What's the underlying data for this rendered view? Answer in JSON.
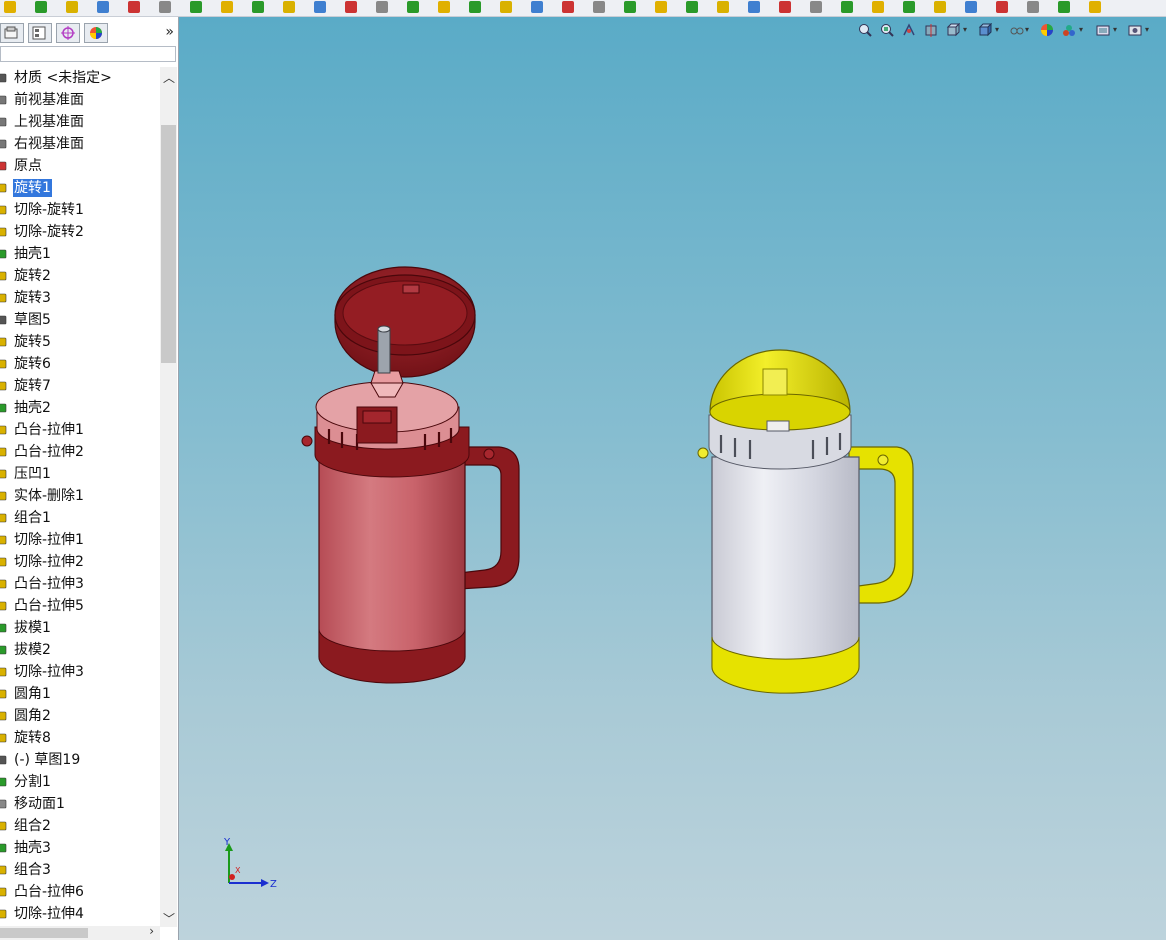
{
  "window": {
    "toolbar": {
      "icon_count": 36
    },
    "panel": {
      "tabs": [
        "feature-manager-tab",
        "property-manager-tab",
        "configuration-manager-tab",
        "display-manager-tab"
      ],
      "expand_glyph": "»"
    },
    "feature_tree": {
      "items": [
        {
          "label": "材质 <未指定>",
          "icon": "material-icon",
          "selected": false
        },
        {
          "label": "前视基准面",
          "icon": "plane-icon",
          "selected": false
        },
        {
          "label": "上视基准面",
          "icon": "plane-icon",
          "selected": false
        },
        {
          "label": "右视基准面",
          "icon": "plane-icon",
          "selected": false
        },
        {
          "label": "原点",
          "icon": "origin-icon",
          "selected": false
        },
        {
          "label": "旋转1",
          "icon": "revolve-icon",
          "selected": true
        },
        {
          "label": "切除-旋转1",
          "icon": "cut-revolve-icon",
          "selected": false
        },
        {
          "label": "切除-旋转2",
          "icon": "cut-revolve-icon",
          "selected": false
        },
        {
          "label": "抽壳1",
          "icon": "shell-icon",
          "selected": false
        },
        {
          "label": "旋转2",
          "icon": "revolve-icon",
          "selected": false
        },
        {
          "label": "旋转3",
          "icon": "revolve-icon",
          "selected": false
        },
        {
          "label": "草图5",
          "icon": "sketch-icon",
          "selected": false
        },
        {
          "label": "旋转5",
          "icon": "revolve-icon",
          "selected": false
        },
        {
          "label": "旋转6",
          "icon": "revolve-icon",
          "selected": false
        },
        {
          "label": "旋转7",
          "icon": "revolve-icon",
          "selected": false
        },
        {
          "label": "抽壳2",
          "icon": "shell-icon",
          "selected": false
        },
        {
          "label": "凸台-拉伸1",
          "icon": "boss-extrude-icon",
          "selected": false
        },
        {
          "label": "凸台-拉伸2",
          "icon": "boss-extrude-icon",
          "selected": false
        },
        {
          "label": "压凹1",
          "icon": "indent-icon",
          "selected": false
        },
        {
          "label": "实体-删除1",
          "icon": "delete-body-icon",
          "selected": false
        },
        {
          "label": "组合1",
          "icon": "combine-icon",
          "selected": false
        },
        {
          "label": "切除-拉伸1",
          "icon": "cut-extrude-icon",
          "selected": false
        },
        {
          "label": "切除-拉伸2",
          "icon": "cut-extrude-icon",
          "selected": false
        },
        {
          "label": "凸台-拉伸3",
          "icon": "boss-extrude-icon",
          "selected": false
        },
        {
          "label": "凸台-拉伸5",
          "icon": "boss-extrude-icon",
          "selected": false
        },
        {
          "label": "拔模1",
          "icon": "draft-icon",
          "selected": false
        },
        {
          "label": "拔模2",
          "icon": "draft-icon",
          "selected": false
        },
        {
          "label": "切除-拉伸3",
          "icon": "cut-extrude-icon",
          "selected": false
        },
        {
          "label": "圆角1",
          "icon": "fillet-icon",
          "selected": false
        },
        {
          "label": "圆角2",
          "icon": "fillet-icon",
          "selected": false
        },
        {
          "label": "旋转8",
          "icon": "revolve-icon",
          "selected": false
        },
        {
          "label": "(-) 草图19",
          "icon": "sketch-icon",
          "selected": false
        },
        {
          "label": "分割1",
          "icon": "split-icon",
          "selected": false
        },
        {
          "label": "移动面1",
          "icon": "move-face-icon",
          "selected": false
        },
        {
          "label": "组合2",
          "icon": "combine-icon",
          "selected": false
        },
        {
          "label": "抽壳3",
          "icon": "shell-icon",
          "selected": false
        },
        {
          "label": "组合3",
          "icon": "combine-icon",
          "selected": false
        },
        {
          "label": "凸台-拉伸6",
          "icon": "boss-extrude-icon",
          "selected": false
        },
        {
          "label": "切除-拉伸4",
          "icon": "cut-extrude-icon",
          "selected": false
        }
      ]
    },
    "viewport": {
      "triad": {
        "y_label": "Y",
        "x_label": "X",
        "z_label": "Z"
      },
      "colors": {
        "red_body": "#c85f66",
        "red_dark": "#8b1a1f",
        "yellow": "#e6e200",
        "silver": "#d4d6e0"
      }
    }
  }
}
